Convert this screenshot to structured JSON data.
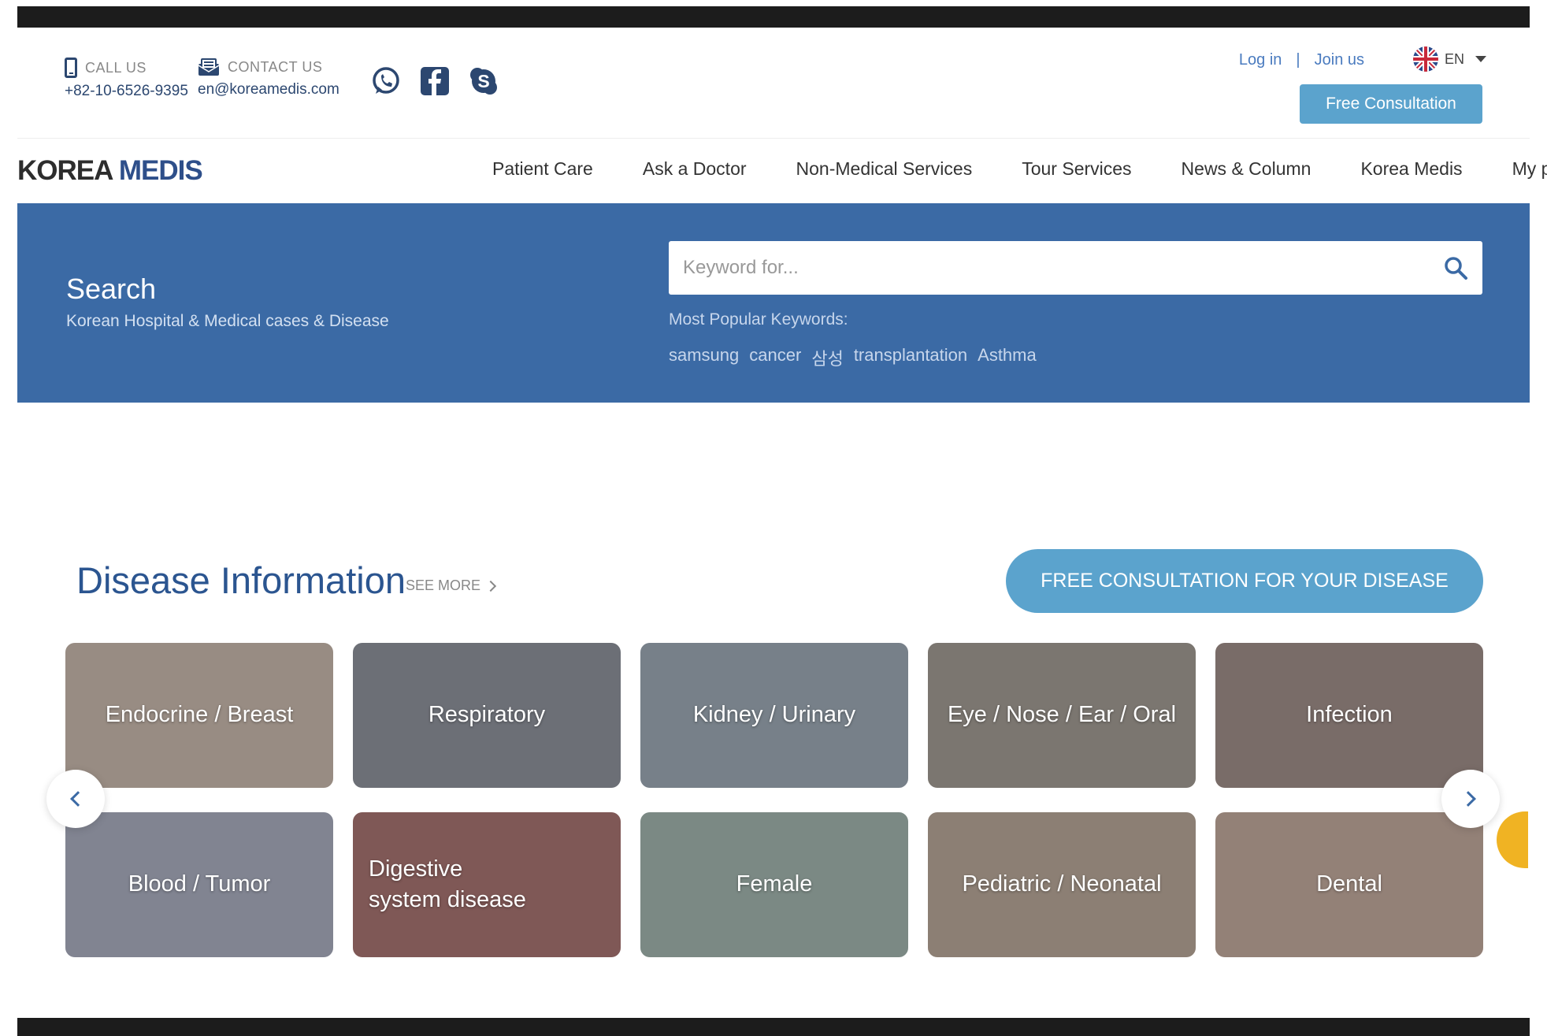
{
  "contact": {
    "call_label": "CALL US",
    "call_value": "+82-10-6526-9395",
    "contact_label": "CONTACT US",
    "contact_value": "en@koreamedis.com"
  },
  "social": [
    "whatsapp-icon",
    "facebook-icon",
    "skype-icon"
  ],
  "auth": {
    "login": "Log in",
    "separator": "|",
    "join": "Join us"
  },
  "language": {
    "code": "EN"
  },
  "header_cta": "Free Consultation",
  "logo": {
    "part1": "KOREA",
    "part2": "MEDIS"
  },
  "nav": [
    "Patient Care",
    "Ask a Doctor",
    "Non-Medical Services",
    "Tour Services",
    "News & Column",
    "Korea Medis",
    "My page"
  ],
  "search": {
    "title": "Search",
    "subtitle": "Korean Hospital & Medical cases & Disease",
    "placeholder": "Keyword for...",
    "popular_label": "Most Popular Keywords:",
    "keywords": [
      "samsung",
      "cancer",
      "삼성",
      "transplantation",
      "Asthma"
    ]
  },
  "disease": {
    "title": "Disease Information",
    "see_more": "SEE MORE",
    "cta": "FREE CONSULTATION FOR YOUR DISEASE",
    "cards": [
      {
        "label": "Endocrine / Breast",
        "color": "#c9b8ab"
      },
      {
        "label": "Respiratory",
        "color": "#8a8f98"
      },
      {
        "label": "Kidney / Urinary",
        "color": "#9aa6b4"
      },
      {
        "label": "Eye / Nose / Ear / Oral",
        "color": "#a09890"
      },
      {
        "label": "Infection",
        "color": "#9c8a84"
      },
      {
        "label": "Blood / Tumor",
        "color": "#a8adbf"
      },
      {
        "label": "Digestive system disease",
        "color": "#a56e6a"
      },
      {
        "label": "Female",
        "color": "#9fb4ac"
      },
      {
        "label": "Pediatric / Neonatal",
        "color": "#b8a596"
      },
      {
        "label": "Dental",
        "color": "#c2a89a"
      }
    ]
  },
  "colors": {
    "brand_blue": "#3b6aa5",
    "accent": "#5ba3cd",
    "title_blue": "#2b5590"
  }
}
